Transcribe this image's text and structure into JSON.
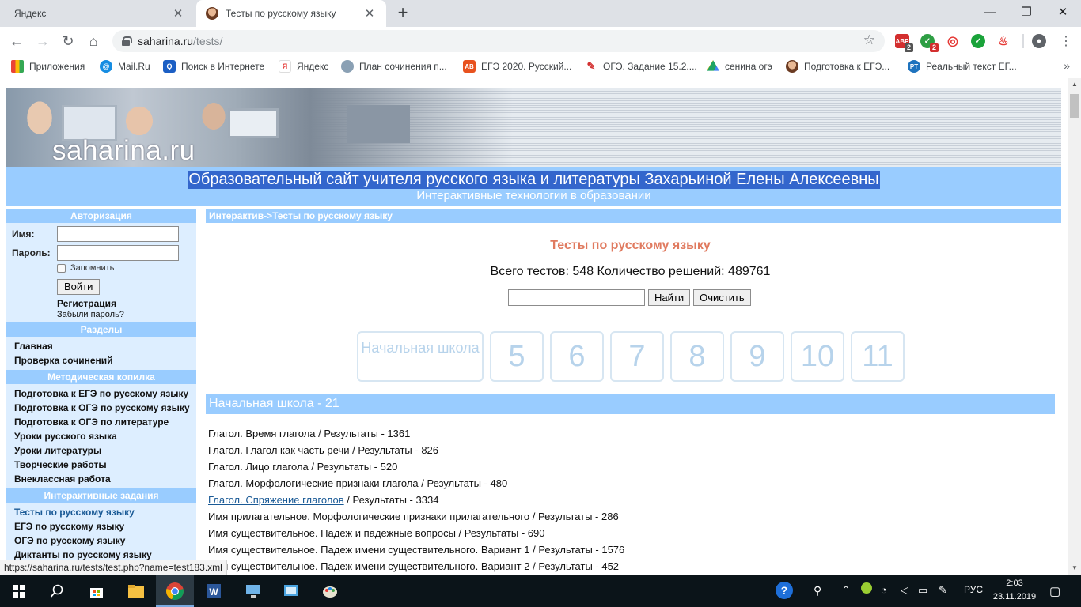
{
  "browser": {
    "tabs": [
      {
        "title": "Яндекс",
        "active": false
      },
      {
        "title": "Тесты по русскому языку",
        "active": true
      }
    ],
    "new_tab": "+",
    "window_controls": {
      "minimize": "—",
      "maximize": "❐",
      "close": "✕"
    },
    "nav": {
      "back": "←",
      "forward": "→",
      "reload": "↻",
      "home": "⌂"
    },
    "url_host": "saharina.ru",
    "url_path": "/tests/",
    "bookmark_star": "☆",
    "extensions": [
      {
        "name": "adblock",
        "badge": "2",
        "color": "#d32f2f",
        "label": "ABP"
      },
      {
        "name": "checker",
        "badge": "2",
        "color": "#2e9e44",
        "label": "✓"
      },
      {
        "name": "target",
        "badge": "",
        "color": "#e53935",
        "label": "◎"
      },
      {
        "name": "check-green",
        "badge": "",
        "color": "#1aa33a",
        "label": "✓"
      },
      {
        "name": "fire",
        "badge": "",
        "color": "#e53935",
        "label": "♨"
      }
    ],
    "bookmarks": [
      {
        "label": "Приложения",
        "icon": "apps-grid-icon",
        "color": "#4285f4"
      },
      {
        "label": "Mail.Ru",
        "icon": "mailru-icon",
        "color": "#168de2"
      },
      {
        "label": "Поиск в Интернете",
        "icon": "search-icon",
        "color": "#1c5fc4"
      },
      {
        "label": "Яндекс",
        "icon": "yandex-icon",
        "color": "#ffffff"
      },
      {
        "label": "План сочинения п...",
        "icon": "figure-icon",
        "color": "#8aa0b4"
      },
      {
        "label": "ЕГЭ 2020. Русский...",
        "icon": "ab-icon",
        "color": "#e8521f"
      },
      {
        "label": "ОГЭ. Задание 15.2....",
        "icon": "pen-icon",
        "color": "#d32f2f"
      },
      {
        "label": "сенина огэ",
        "icon": "google-drive-icon",
        "color": "#1fa463"
      },
      {
        "label": "Подготовка к ЕГЭ...",
        "icon": "avatar-icon",
        "color": "#b07a5c"
      },
      {
        "label": "Реальный текст ЕГ...",
        "icon": "pt-icon",
        "color": "#1e73be"
      }
    ],
    "bookmarks_more": "»",
    "status_url": "https://saharina.ru/tests/test.php?name=test183.xml"
  },
  "site": {
    "brand": "saharina.ru",
    "headline": "Образовательный сайт учителя русского языка и литературы Захарьиной Елены Алексеевны",
    "subheadline": "Интерактивные технологии в образовании"
  },
  "sidebar": {
    "auth_header": "Авторизация",
    "username_label": "Имя:",
    "password_label": "Пароль:",
    "remember_label": "Запомнить",
    "login_button": "Войти",
    "register_link": "Регистрация",
    "forgot_link": "Забыли пароль?",
    "sections": [
      {
        "header": "Разделы",
        "items": [
          "Главная",
          "Проверка сочинений"
        ]
      },
      {
        "header": "Методическая копилка",
        "items": [
          "Подготовка к ЕГЭ по русскому языку",
          "Подготовка к ОГЭ по русскому языку",
          "Подготовка к ОГЭ по литературе",
          "Уроки русского языка",
          "Уроки литературы",
          "Творческие работы",
          "Внеклассная работа"
        ]
      },
      {
        "header": "Интерактивные задания",
        "items": [
          "Тесты по русскому языку",
          "ЕГЭ по русскому языку",
          "ОГЭ по русскому языку",
          "Диктанты по русскому языку"
        ]
      }
    ]
  },
  "main": {
    "breadcrumb": "Интерактив->Тесты по русскому языку",
    "title": "Тесты по русскому языку",
    "stats": "Всего тестов: 548 Количество решений: 489761",
    "search_value": "",
    "search_button": "Найти",
    "clear_button": "Очистить",
    "grades": [
      "Начальная школа",
      "5",
      "6",
      "7",
      "8",
      "9",
      "10",
      "11"
    ],
    "section_title": "Начальная школа - 21",
    "tests": [
      {
        "name": "Глагол. Время глагола",
        "results": "Результаты - 1361",
        "hovered": false
      },
      {
        "name": "Глагол. Глагол как часть речи",
        "results": "Результаты - 826",
        "hovered": false
      },
      {
        "name": "Глагол. Лицо глагола",
        "results": "Результаты - 520",
        "hovered": false
      },
      {
        "name": "Глагол. Морфологические признаки глагола",
        "results": "Результаты - 480",
        "hovered": false
      },
      {
        "name": "Глагол. Спряжение глаголов",
        "results": "Результаты - 3334",
        "hovered": true
      },
      {
        "name": "Имя прилагательное. Морфологические признаки прилагательного",
        "results": "Результаты - 286",
        "hovered": false
      },
      {
        "name": "Имя существительное. Падеж и падежные вопросы",
        "results": "Результаты - 690",
        "hovered": false
      },
      {
        "name": "Имя существительное. Падеж имени существительного. Вариант 1",
        "results": "Результаты - 1576",
        "hovered": false
      },
      {
        "name": "Имя существительное. Падеж имени существительного. Вариант 2",
        "results": "Результаты - 452",
        "hovered": false
      }
    ],
    "separator": " / "
  },
  "taskbar": {
    "lang": "РУС",
    "time": "2:03",
    "date": "23.11.2019",
    "apps": [
      "windows-start-icon",
      "search-icon",
      "store-icon",
      "file-explorer-icon",
      "chrome-icon",
      "word-icon",
      "pc-icon",
      "media-icon",
      "paint-icon"
    ]
  },
  "colors": {
    "band": "#99ccff",
    "sidebar_bg": "#ddeeff",
    "title": "#e07a5f",
    "grade_text": "#b7d3eb",
    "highlight": "#3366cc"
  }
}
